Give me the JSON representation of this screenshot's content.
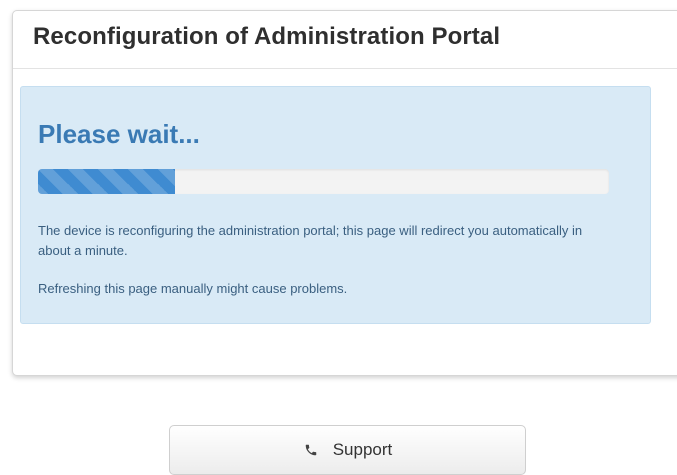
{
  "panel": {
    "title": "Reconfiguration of Administration Portal"
  },
  "alert": {
    "heading": "Please wait...",
    "progress_percent": 24,
    "message": "The device is reconfiguring the administration portal; this page will redirect you automatically in about a minute.",
    "warning": "Refreshing this page manually might cause problems."
  },
  "support": {
    "label": "Support",
    "icon": "phone-icon"
  },
  "colors": {
    "alert_background": "#d9eaf6",
    "heading": "#3a7ab4",
    "progress_bar": "#3f8bd1"
  }
}
